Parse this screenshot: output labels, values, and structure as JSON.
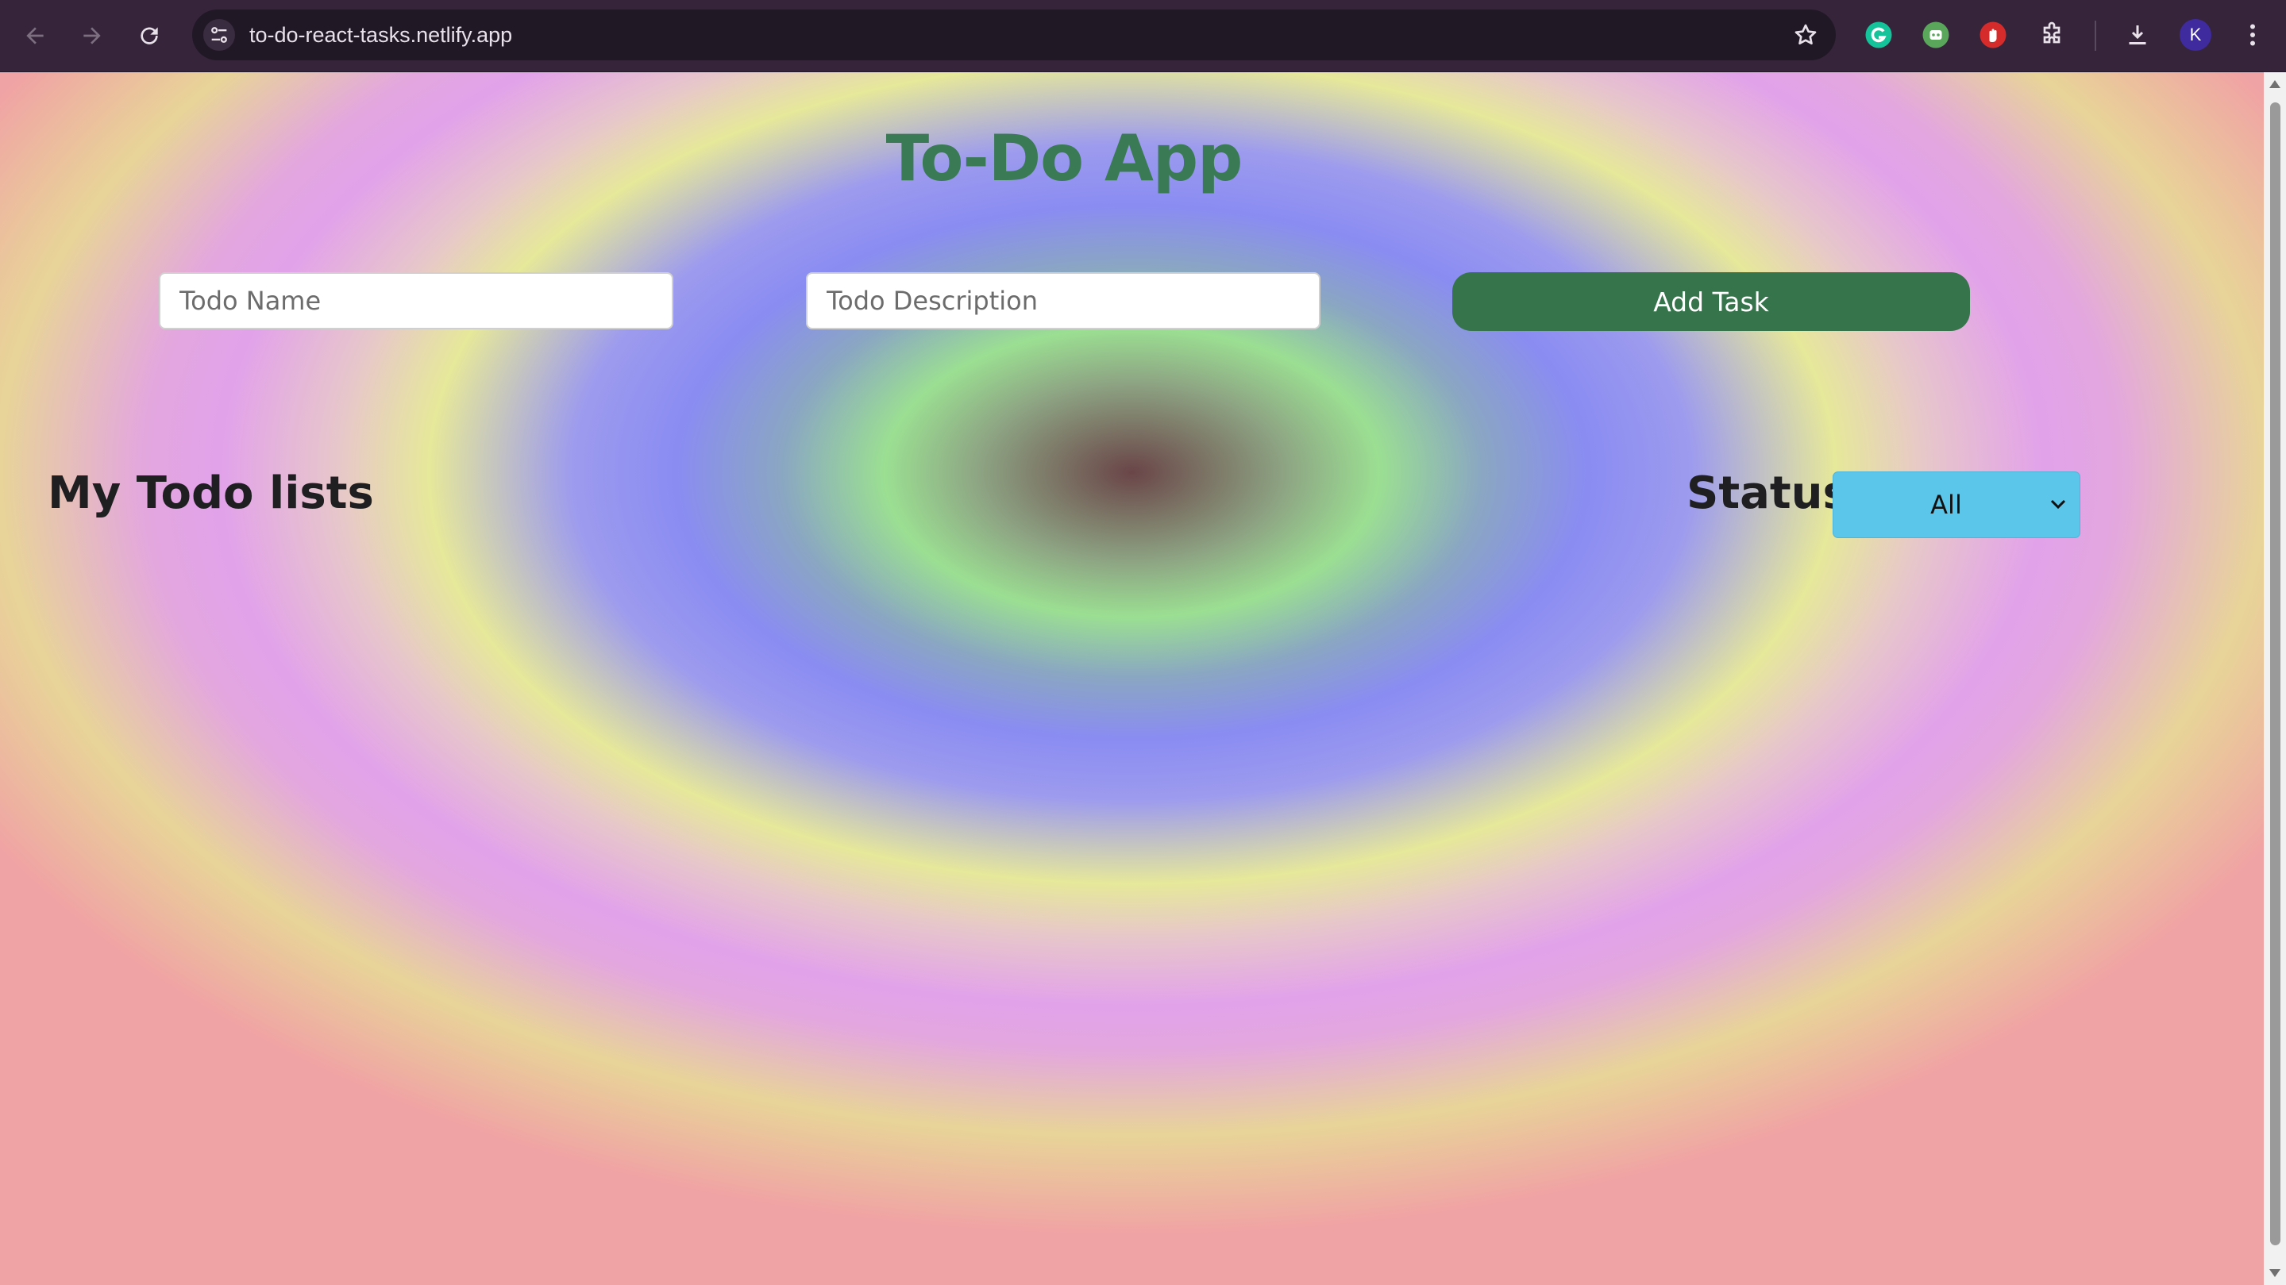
{
  "browser": {
    "url": "to-do-react-tasks.netlify.app",
    "profile_initial": "K",
    "icons": [
      "back-arrow-icon",
      "forward-arrow-icon",
      "reload-icon",
      "site-info-icon",
      "bookmark-star-icon",
      "grammarly-icon",
      "extension-robot-icon",
      "extension-hand-icon",
      "extensions-puzzle-icon",
      "download-icon",
      "more-vert-icon"
    ]
  },
  "app": {
    "title": "To-Do App",
    "todo_name_placeholder": "Todo Name",
    "todo_description_placeholder": "Todo Description",
    "add_task_label": "Add Task",
    "list_heading": "My Todo lists",
    "status_label": "Status:",
    "status_selected": "All"
  },
  "colors": {
    "title": "#3a7a55",
    "add_button": "#36744c",
    "status_select": "#5bc6ea"
  }
}
